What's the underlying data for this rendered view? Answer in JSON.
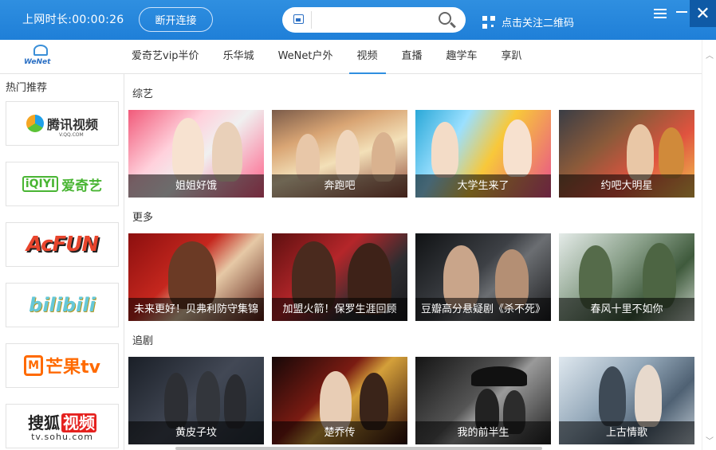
{
  "header": {
    "online_time_label": "上网时长:",
    "online_time_value": "00:00:26",
    "disconnect_label": "断开连接",
    "search_value": "",
    "qr_label": "点击关注二维码",
    "close_glyph": "✕"
  },
  "nav": {
    "logo_text": "WeNet",
    "tabs": [
      {
        "label": "爱奇艺vip半价",
        "active": false
      },
      {
        "label": "乐华城",
        "active": false
      },
      {
        "label": "WeNet户外",
        "active": false
      },
      {
        "label": "视频",
        "active": true
      },
      {
        "label": "直播",
        "active": false
      },
      {
        "label": "趣学车",
        "active": false
      },
      {
        "label": "享趴",
        "active": false
      }
    ]
  },
  "sidebar": {
    "title": "热门推荐",
    "platforms": [
      {
        "name": "腾讯视频",
        "sub": "V.QQ.COM"
      },
      {
        "name": "爱奇艺",
        "mark": "iQIYI"
      },
      {
        "name": "AcFUN"
      },
      {
        "name": "bilibili"
      },
      {
        "name": "芒果tv",
        "mark": "M"
      },
      {
        "name": "搜狐",
        "mark": "视频",
        "sub": "tv.sohu.com"
      }
    ]
  },
  "sections": [
    {
      "title": "综艺",
      "cards": [
        "姐姐好饿",
        "奔跑吧",
        "大学生来了",
        "约吧大明星"
      ]
    },
    {
      "title": "更多",
      "cards": [
        "未来更好！贝弗利防守集锦",
        "加盟火箭！保罗生涯回顾",
        "豆瓣高分悬疑剧《杀不死》",
        "春风十里不如你"
      ]
    },
    {
      "title": "追剧",
      "cards": [
        "黄皮子坟",
        "楚乔传",
        "我的前半生",
        "上古情歌"
      ]
    }
  ],
  "scroll": {
    "up_glyph": "︿",
    "down_glyph": "﹀"
  }
}
